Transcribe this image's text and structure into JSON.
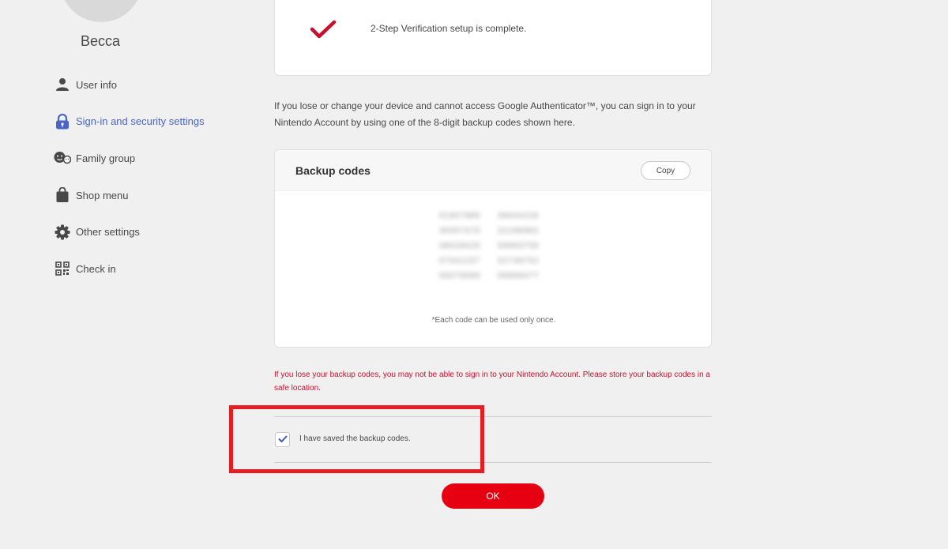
{
  "user": {
    "name": "Becca"
  },
  "sidebar": {
    "items": [
      {
        "label": "User info",
        "icon": "user-icon",
        "active": false
      },
      {
        "label": "Sign-in and security settings",
        "icon": "lock-icon",
        "active": true
      },
      {
        "label": "Family group",
        "icon": "family-icon",
        "active": false
      },
      {
        "label": "Shop menu",
        "icon": "shopping-bag-icon",
        "active": false
      },
      {
        "label": "Other settings",
        "icon": "gear-icon",
        "active": false
      },
      {
        "label": "Check in",
        "icon": "qr-code-icon",
        "active": false
      }
    ]
  },
  "verification": {
    "complete_text": "2-Step Verification setup is complete.",
    "icon": "checkmark-icon"
  },
  "info_text": "If you lose or change your device and cannot access Google Authenticator™, you can sign in to your Nintendo Account by using one of the 8-digit backup codes shown here.",
  "backup_codes": {
    "title": "Backup codes",
    "copy_label": "Copy",
    "codes": [
      "01907985",
      "39644226",
      "30057470",
      "31168983",
      "48028420",
      "59993755",
      "07041157",
      "02739752",
      "00076590",
      "09998477"
    ],
    "note": "*Each code can be used only once."
  },
  "warning_text": "If you lose your backup codes, you may not be able to sign in to your Nintendo Account. Please store your backup codes in a safe location.",
  "confirm": {
    "label": "I have saved the backup codes.",
    "checked": true
  },
  "ok_label": "OK",
  "colors": {
    "accent_red": "#e60012",
    "active_nav_blue": "#4a64c8",
    "warning_red": "#c8102e",
    "annotation_red": "#e51e24",
    "background": "#f0f0f0"
  }
}
